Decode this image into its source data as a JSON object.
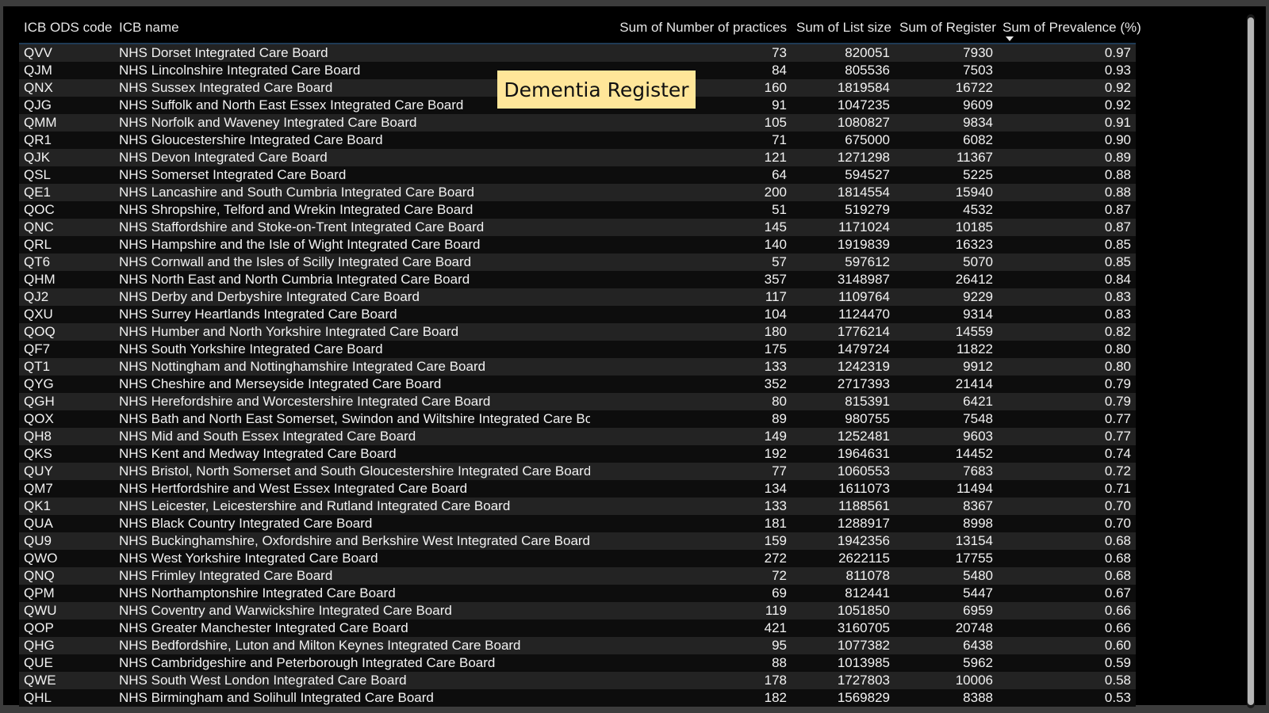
{
  "title": "Dementia Register",
  "columns": [
    {
      "label": "ICB ODS code",
      "align": "left"
    },
    {
      "label": "ICB name",
      "align": "left"
    },
    {
      "label": "Sum of Number of practices",
      "align": "right"
    },
    {
      "label": "Sum of List size",
      "align": "right"
    },
    {
      "label": "Sum of Register",
      "align": "right"
    },
    {
      "label": "Sum of Prevalence (%)",
      "align": "right",
      "sorted": "descending"
    }
  ],
  "rows": [
    [
      "QVV",
      "NHS Dorset Integrated Care Board",
      "73",
      "820051",
      "7930",
      "0.97"
    ],
    [
      "QJM",
      "NHS Lincolnshire Integrated Care Board",
      "84",
      "805536",
      "7503",
      "0.93"
    ],
    [
      "QNX",
      "NHS Sussex Integrated Care Board",
      "160",
      "1819584",
      "16722",
      "0.92"
    ],
    [
      "QJG",
      "NHS Suffolk and North East Essex Integrated Care Board",
      "91",
      "1047235",
      "9609",
      "0.92"
    ],
    [
      "QMM",
      "NHS Norfolk and Waveney Integrated Care Board",
      "105",
      "1080827",
      "9834",
      "0.91"
    ],
    [
      "QR1",
      "NHS Gloucestershire Integrated Care Board",
      "71",
      "675000",
      "6082",
      "0.90"
    ],
    [
      "QJK",
      "NHS Devon Integrated Care Board",
      "121",
      "1271298",
      "11367",
      "0.89"
    ],
    [
      "QSL",
      "NHS Somerset Integrated Care Board",
      "64",
      "594527",
      "5225",
      "0.88"
    ],
    [
      "QE1",
      "NHS Lancashire and South Cumbria Integrated Care Board",
      "200",
      "1814554",
      "15940",
      "0.88"
    ],
    [
      "QOC",
      "NHS Shropshire, Telford and Wrekin Integrated Care Board",
      "51",
      "519279",
      "4532",
      "0.87"
    ],
    [
      "QNC",
      "NHS Staffordshire and Stoke-on-Trent Integrated Care Board",
      "145",
      "1171024",
      "10185",
      "0.87"
    ],
    [
      "QRL",
      "NHS Hampshire and the Isle of Wight Integrated Care Board",
      "140",
      "1919839",
      "16323",
      "0.85"
    ],
    [
      "QT6",
      "NHS Cornwall and the Isles of Scilly Integrated Care Board",
      "57",
      "597612",
      "5070",
      "0.85"
    ],
    [
      "QHM",
      "NHS North East and North Cumbria Integrated Care Board",
      "357",
      "3148987",
      "26412",
      "0.84"
    ],
    [
      "QJ2",
      "NHS Derby and Derbyshire Integrated Care Board",
      "117",
      "1109764",
      "9229",
      "0.83"
    ],
    [
      "QXU",
      "NHS Surrey Heartlands Integrated Care Board",
      "104",
      "1124470",
      "9314",
      "0.83"
    ],
    [
      "QOQ",
      "NHS Humber and North Yorkshire Integrated Care Board",
      "180",
      "1776214",
      "14559",
      "0.82"
    ],
    [
      "QF7",
      "NHS South Yorkshire Integrated Care Board",
      "175",
      "1479724",
      "11822",
      "0.80"
    ],
    [
      "QT1",
      "NHS Nottingham and Nottinghamshire Integrated Care Board",
      "133",
      "1242319",
      "9912",
      "0.80"
    ],
    [
      "QYG",
      "NHS Cheshire and Merseyside Integrated Care Board",
      "352",
      "2717393",
      "21414",
      "0.79"
    ],
    [
      "QGH",
      "NHS Herefordshire and Worcestershire Integrated Care Board",
      "80",
      "815391",
      "6421",
      "0.79"
    ],
    [
      "QOX",
      "NHS Bath and North East Somerset, Swindon and Wiltshire Integrated Care Board",
      "89",
      "980755",
      "7548",
      "0.77"
    ],
    [
      "QH8",
      "NHS Mid and South Essex Integrated Care Board",
      "149",
      "1252481",
      "9603",
      "0.77"
    ],
    [
      "QKS",
      "NHS Kent and Medway Integrated Care Board",
      "192",
      "1964631",
      "14452",
      "0.74"
    ],
    [
      "QUY",
      "NHS Bristol, North Somerset and South Gloucestershire Integrated Care Board",
      "77",
      "1060553",
      "7683",
      "0.72"
    ],
    [
      "QM7",
      "NHS Hertfordshire and West Essex Integrated Care Board",
      "134",
      "1611073",
      "11494",
      "0.71"
    ],
    [
      "QK1",
      "NHS Leicester, Leicestershire and Rutland Integrated Care Board",
      "133",
      "1188561",
      "8367",
      "0.70"
    ],
    [
      "QUA",
      "NHS Black Country Integrated Care Board",
      "181",
      "1288917",
      "8998",
      "0.70"
    ],
    [
      "QU9",
      "NHS Buckinghamshire, Oxfordshire and Berkshire West Integrated Care Board",
      "159",
      "1942356",
      "13154",
      "0.68"
    ],
    [
      "QWO",
      "NHS West Yorkshire Integrated Care Board",
      "272",
      "2622115",
      "17755",
      "0.68"
    ],
    [
      "QNQ",
      "NHS Frimley Integrated Care Board",
      "72",
      "811078",
      "5480",
      "0.68"
    ],
    [
      "QPM",
      "NHS Northamptonshire Integrated Care Board",
      "69",
      "812441",
      "5447",
      "0.67"
    ],
    [
      "QWU",
      "NHS Coventry and Warwickshire Integrated Care Board",
      "119",
      "1051850",
      "6959",
      "0.66"
    ],
    [
      "QOP",
      "NHS Greater Manchester Integrated Care Board",
      "421",
      "3160705",
      "20748",
      "0.66"
    ],
    [
      "QHG",
      "NHS Bedfordshire, Luton and Milton Keynes Integrated Care Board",
      "95",
      "1077382",
      "6438",
      "0.60"
    ],
    [
      "QUE",
      "NHS Cambridgeshire and Peterborough Integrated Care Board",
      "88",
      "1013985",
      "5962",
      "0.59"
    ],
    [
      "QWE",
      "NHS South West London Integrated Care Board",
      "178",
      "1727803",
      "10006",
      "0.58"
    ],
    [
      "QHL",
      "NHS Birmingham and Solihull Integrated Care Board",
      "182",
      "1569829",
      "8388",
      "0.53"
    ]
  ]
}
